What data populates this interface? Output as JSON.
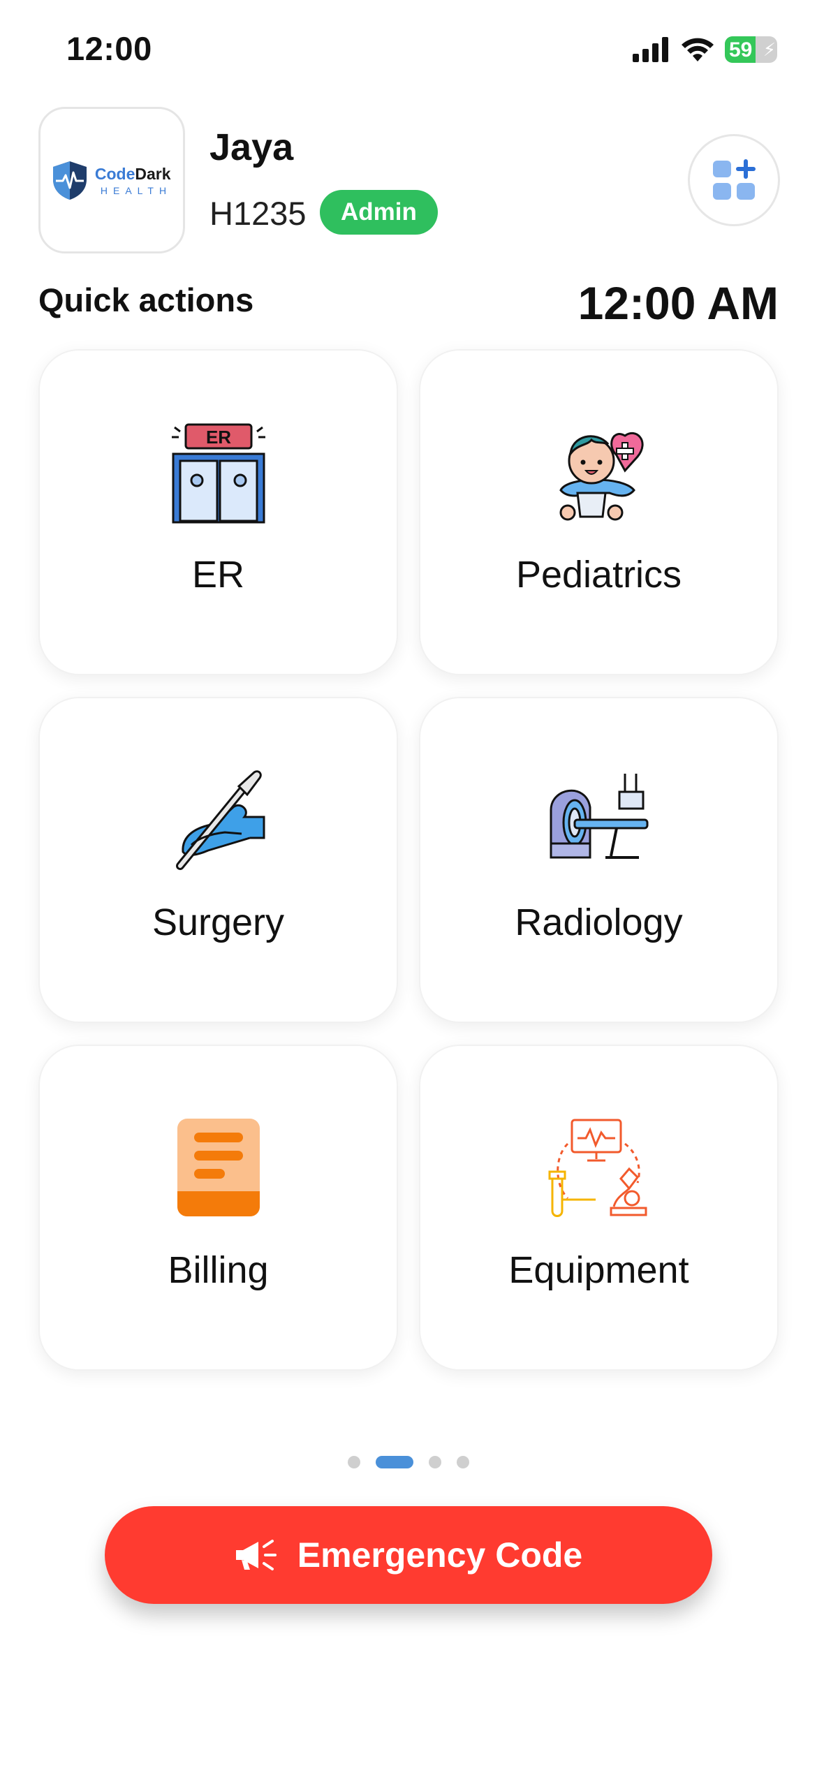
{
  "status_bar": {
    "time": "12:00",
    "battery_percent": "59",
    "icons": [
      "cellular-signal-icon",
      "wifi-icon",
      "battery-charging-icon"
    ]
  },
  "header": {
    "logo": {
      "word_code": "Code",
      "word_dark": "Dark",
      "word_health": "HEALTH"
    },
    "user_name": "Jaya",
    "user_id": "H1235",
    "role": "Admin",
    "apps_icon": "apps-add-icon"
  },
  "quick_actions": {
    "title": "Quick actions",
    "clock": "12:00 AM",
    "tiles": [
      {
        "label": "ER",
        "icon": "er-doors-icon"
      },
      {
        "label": "Pediatrics",
        "icon": "baby-heart-icon"
      },
      {
        "label": "Surgery",
        "icon": "scalpel-hand-icon"
      },
      {
        "label": "Radiology",
        "icon": "mri-scanner-icon"
      },
      {
        "label": "Billing",
        "icon": "bill-document-icon"
      },
      {
        "label": "Equipment",
        "icon": "lab-equipment-icon"
      }
    ]
  },
  "pager": {
    "total": 4,
    "active_index": 1
  },
  "emergency": {
    "label": "Emergency Code",
    "icon": "megaphone-icon"
  },
  "colors": {
    "accent_blue": "#4a90d9",
    "admin_green": "#2fbf5e",
    "emergency_red": "#ff3b30",
    "battery_green": "#34c759"
  }
}
